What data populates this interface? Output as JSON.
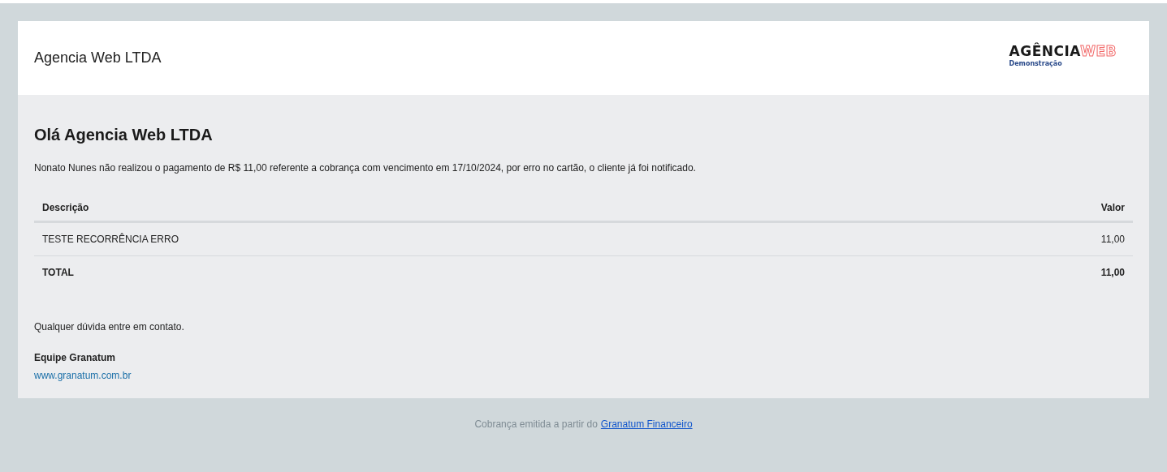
{
  "header": {
    "company": "Agencia Web LTDA",
    "logo": {
      "word_1": "AGÊNCIA",
      "word_2": "WEB",
      "tagline": "Demonstração"
    }
  },
  "greeting": "Olá Agencia Web LTDA",
  "message": "Nonato Nunes não realizou o pagamento de R$ 11,00 referente a cobrança com vencimento em 17/10/2024, por erro no cartão, o cliente já foi notificado.",
  "table": {
    "columns": [
      "Descrição",
      "Valor"
    ],
    "rows": [
      {
        "description": "TESTE RECORRÊNCIA ERRO",
        "value": "11,00"
      }
    ],
    "total": {
      "label": "TOTAL",
      "value": "11,00"
    }
  },
  "contact_note": "Qualquer dúvida entre em contato.",
  "signature": {
    "team": "Equipe Granatum",
    "website": "www.granatum.com.br"
  },
  "footer": {
    "text": "Cobrança emitida a partir do",
    "link": "Granatum Financeiro"
  }
}
